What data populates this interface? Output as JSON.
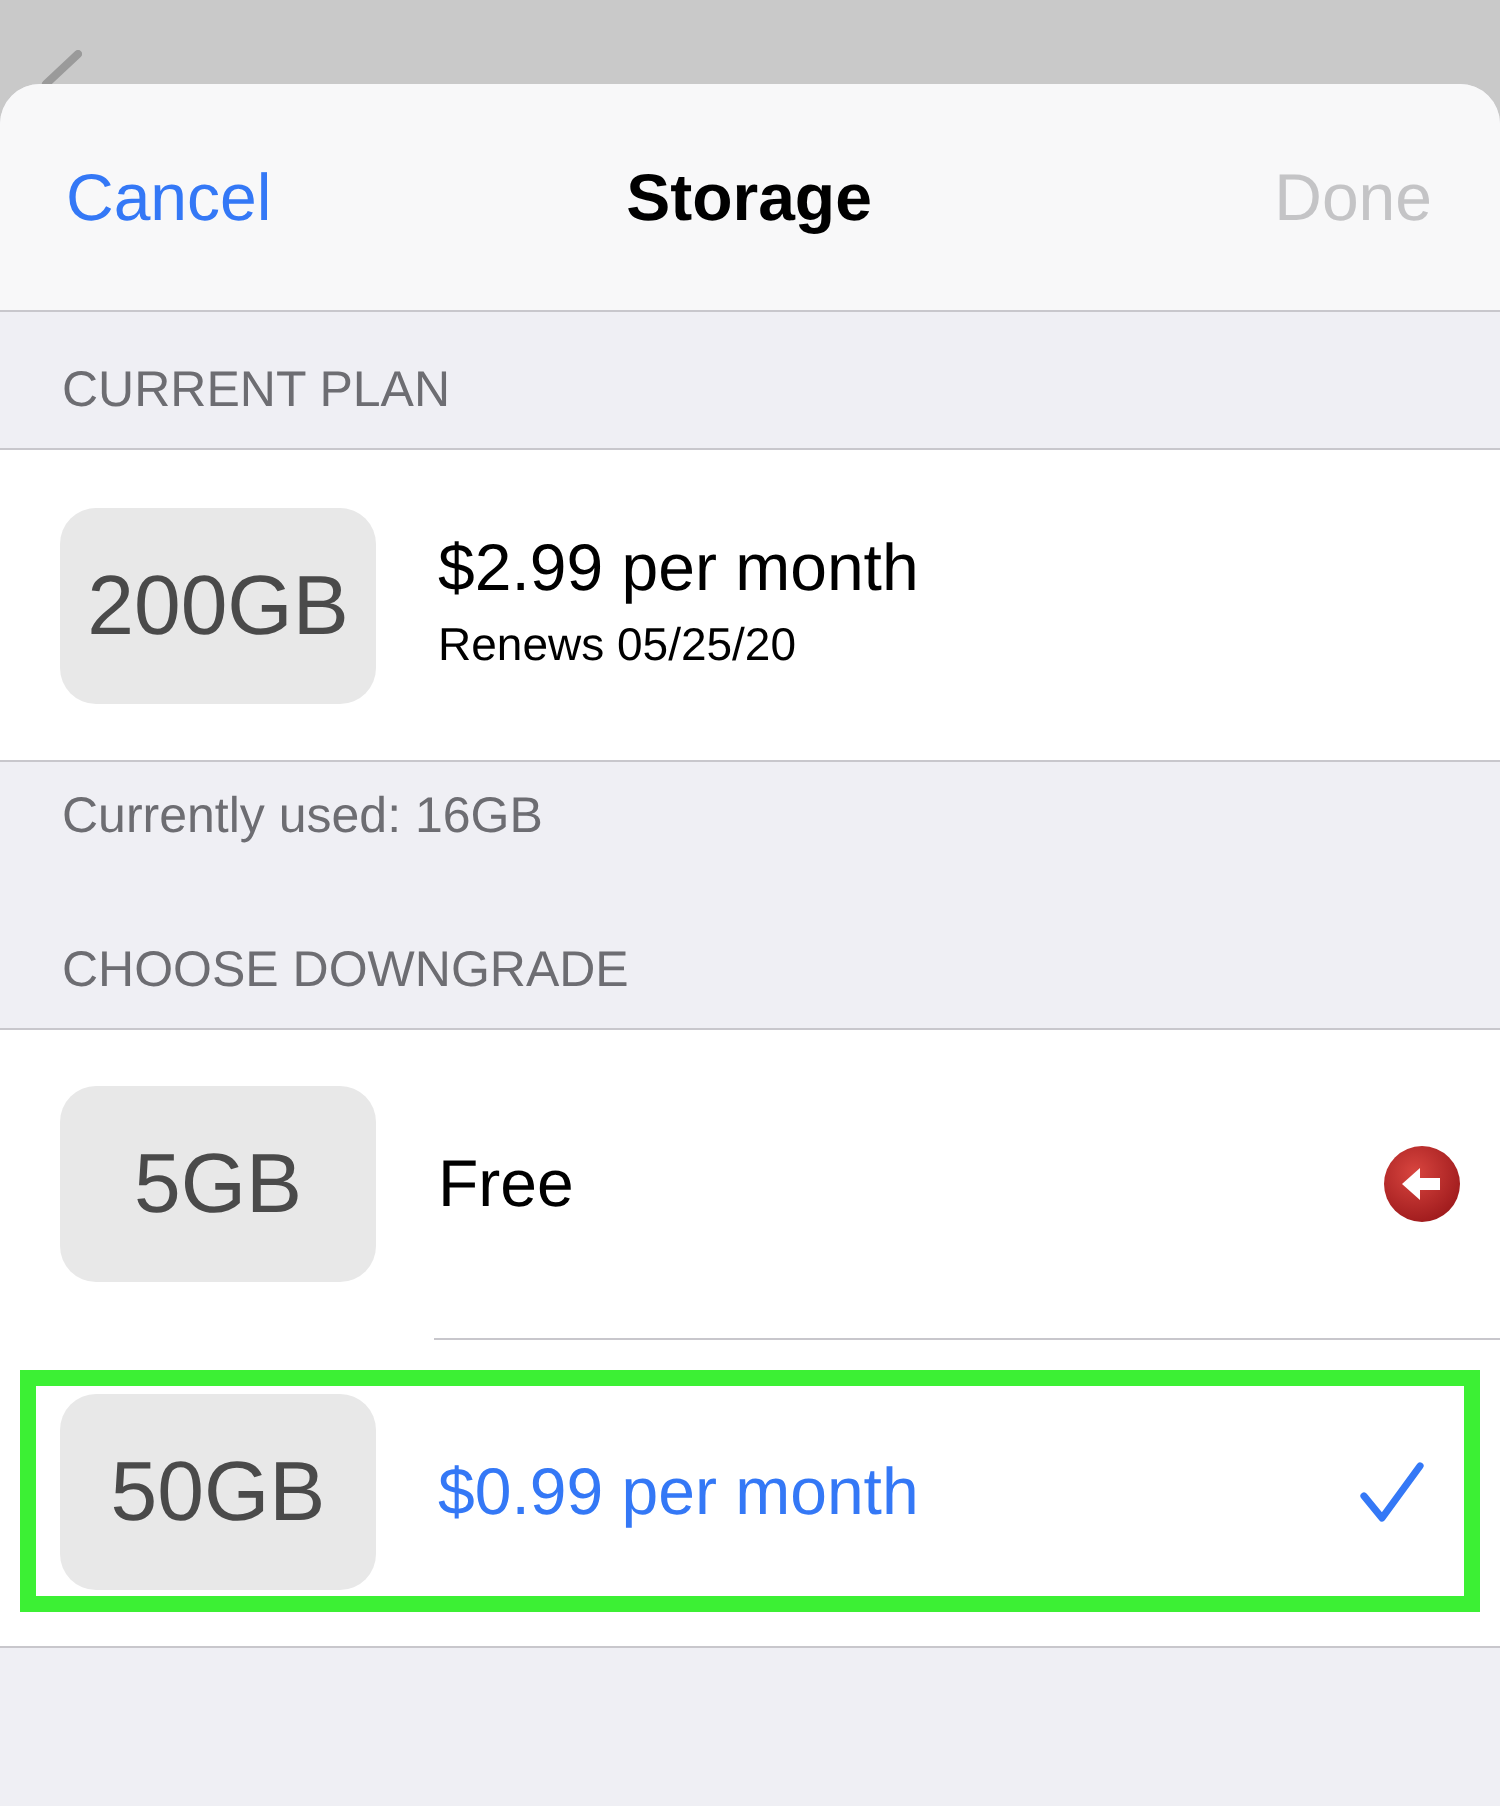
{
  "sheet": {
    "cancel_label": "Cancel",
    "title": "Storage",
    "done": {
      "label": "Done",
      "disabled": true
    }
  },
  "current_plan": {
    "header": "CURRENT PLAN",
    "size": "200GB",
    "price": "$2.99 per month",
    "renewal": "Renews 05/25/20",
    "footer": "Currently used: 16GB"
  },
  "downgrade": {
    "header": "CHOOSE DOWNGRADE",
    "options": [
      {
        "size": "5GB",
        "price": "Free",
        "selected": false,
        "flagged": true,
        "highlighted": false
      },
      {
        "size": "50GB",
        "price": "$0.99 per month",
        "selected": true,
        "flagged": false,
        "highlighted": true
      }
    ]
  }
}
